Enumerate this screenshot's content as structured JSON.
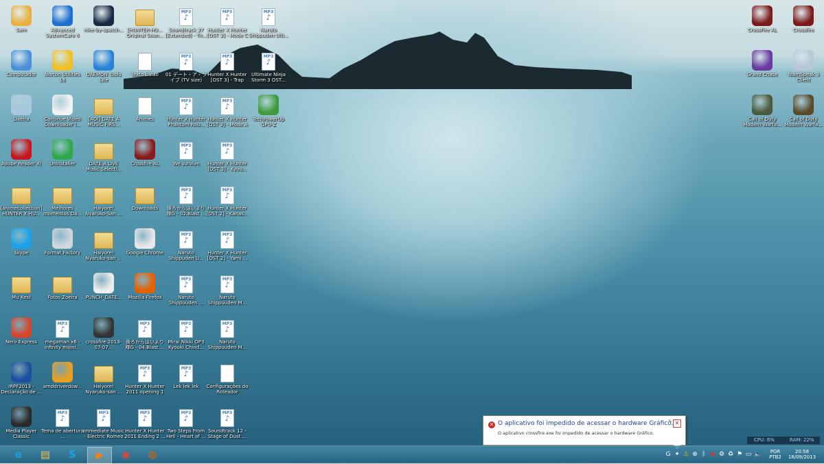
{
  "desktop": {
    "icons": [
      {
        "label": "Sam",
        "icon": "user-icon",
        "kind": "app",
        "color": "#e8b040",
        "col": 0,
        "row": 0
      },
      {
        "label": "Advanced SystemCare 6",
        "icon": "systemcare-icon",
        "kind": "app",
        "color": "#1e6fd0",
        "col": 1,
        "row": 0
      },
      {
        "label": "nike-by-spatch...",
        "icon": "image-icon",
        "kind": "app",
        "color": "#1a2a44",
        "col": 2,
        "row": 0
      },
      {
        "label": "[HUNTER-HU... Original Soun...",
        "icon": "folder-icon",
        "kind": "folder",
        "col": 3,
        "row": 0
      },
      {
        "label": "Soundtrack 37 [Extended] - Th...",
        "icon": "mp3-icon",
        "kind": "mp3",
        "col": 4,
        "row": 0
      },
      {
        "label": "Hunter X Hunter [OST 3] - Mode C",
        "icon": "mp3-icon",
        "kind": "mp3",
        "col": 5,
        "row": 0
      },
      {
        "label": "Naruto Shippuden Ulti...",
        "icon": "mp3-icon",
        "kind": "mp3",
        "col": 6,
        "row": 0
      },
      {
        "label": "Computador",
        "icon": "computer-icon",
        "kind": "app",
        "color": "#4a90d9",
        "col": 0,
        "row": 1
      },
      {
        "label": "Norton Utilities 16",
        "icon": "norton-icon",
        "kind": "app",
        "color": "#f0c020",
        "col": 1,
        "row": 1
      },
      {
        "label": "DAEMON Tools Lite",
        "icon": "daemon-tools-icon",
        "kind": "app",
        "color": "#2a82d8",
        "col": 2,
        "row": 1
      },
      {
        "label": "Texto balao",
        "icon": "text-file-icon",
        "kind": "doc",
        "col": 3,
        "row": 1
      },
      {
        "label": "01 デート・ア・ライブ (TV size)",
        "icon": "mp3-icon",
        "kind": "mp3",
        "col": 4,
        "row": 1
      },
      {
        "label": "Hunter X Hunter [OST 3] - Trap",
        "icon": "mp3-icon",
        "kind": "mp3",
        "col": 5,
        "row": 1
      },
      {
        "label": "Ultimate Ninja Storm 3 OST...",
        "icon": "mp3-icon",
        "kind": "mp3",
        "col": 6,
        "row": 1
      },
      {
        "label": "Lixeira",
        "icon": "recycle-bin-icon",
        "kind": "app",
        "color": "#a9c7de",
        "col": 0,
        "row": 2
      },
      {
        "label": "Continue Video Downloader l...",
        "icon": "video-downloader-icon",
        "kind": "app",
        "color": "#f2f2f2",
        "col": 1,
        "row": 2
      },
      {
        "label": "[AOI] DATE A MUSIC FIRS...",
        "icon": "folder-icon",
        "kind": "folder",
        "col": 2,
        "row": 2
      },
      {
        "label": "Animes",
        "icon": "text-file-icon",
        "kind": "doc",
        "col": 3,
        "row": 2
      },
      {
        "label": "Hunter x Hunter Phantom Rou...",
        "icon": "mp3-icon",
        "kind": "mp3",
        "col": 4,
        "row": 2
      },
      {
        "label": "Hunter X Hunter [OST 3] - Mode A",
        "icon": "mp3-icon",
        "kind": "mp3",
        "col": 5,
        "row": 2
      },
      {
        "label": "TechPowerUp GPU-Z",
        "icon": "gpu-z-icon",
        "kind": "app",
        "color": "#3e9a3e",
        "col": 6,
        "row": 2
      },
      {
        "label": "Adobe Reader XI",
        "icon": "adobe-reader-icon",
        "kind": "app",
        "color": "#c8161d",
        "col": 0,
        "row": 3
      },
      {
        "label": "Uninstaller",
        "icon": "uninstaller-icon",
        "kind": "app",
        "color": "#2da84a",
        "col": 1,
        "row": 3
      },
      {
        "label": "DATE A LIVE Music Selecti...",
        "icon": "folder-icon",
        "kind": "folder",
        "col": 2,
        "row": 3
      },
      {
        "label": "Crossfire AL",
        "icon": "crossfire-icon",
        "kind": "app",
        "color": "#8a1a1a",
        "col": 3,
        "row": 3
      },
      {
        "label": "We survive",
        "icon": "mp3-icon",
        "kind": "mp3",
        "col": 4,
        "row": 3
      },
      {
        "label": "Hunter X Hunter [OST 3] - Kyou...",
        "icon": "mp3-icon",
        "kind": "mp3",
        "col": 5,
        "row": 3
      },
      {
        "label": "[animecollection] HUNTER X HU...",
        "icon": "folder-icon",
        "kind": "folder",
        "col": 0,
        "row": 4
      },
      {
        "label": "Melhores momentos Da...",
        "icon": "folder-icon",
        "kind": "folder",
        "col": 1,
        "row": 4
      },
      {
        "label": "Haiyore! Nyaruko-San ...",
        "icon": "folder-icon",
        "kind": "folder",
        "col": 2,
        "row": 4
      },
      {
        "label": "Downloads",
        "icon": "downloads-folder-icon",
        "kind": "folder",
        "col": 3,
        "row": 4
      },
      {
        "label": "後ろから這いより隊G - 02.Blast ...",
        "icon": "mp3-icon",
        "kind": "mp3",
        "col": 4,
        "row": 4
      },
      {
        "label": "Hunter X Hunter [OST 2] - Kanas...",
        "icon": "mp3-icon",
        "kind": "mp3",
        "col": 5,
        "row": 4
      },
      {
        "label": "Skype",
        "icon": "skype-icon",
        "kind": "app",
        "color": "#1aa3e8",
        "col": 0,
        "row": 5
      },
      {
        "label": "Format Factory",
        "icon": "format-factory-icon",
        "kind": "app",
        "color": "#d0d6de",
        "col": 1,
        "row": 5
      },
      {
        "label": "Haiyore! Nyaruko-san ...",
        "icon": "folder-icon",
        "kind": "folder",
        "col": 2,
        "row": 5
      },
      {
        "label": "Google Chrome",
        "icon": "chrome-icon",
        "kind": "app",
        "color": "#e8e8e8",
        "col": 3,
        "row": 5
      },
      {
        "label": "Naruto Shippuden U...",
        "icon": "mp3-icon",
        "kind": "mp3",
        "col": 4,
        "row": 5
      },
      {
        "label": "Hunter X Hunter [OST 2] - Yami ...",
        "icon": "mp3-icon",
        "kind": "mp3",
        "col": 5,
        "row": 5
      },
      {
        "label": "Mu Kest",
        "icon": "folder-icon",
        "kind": "folder",
        "col": 0,
        "row": 6
      },
      {
        "label": "Fotos Zoeira",
        "icon": "folder-icon",
        "kind": "folder",
        "col": 1,
        "row": 6
      },
      {
        "label": "PUNCH_DATE...",
        "icon": "mkv-file-icon",
        "kind": "app",
        "color": "#eeeeee",
        "col": 2,
        "row": 6
      },
      {
        "label": "Mozilla Firefox",
        "icon": "firefox-icon",
        "kind": "app",
        "color": "#e66000",
        "col": 3,
        "row": 6
      },
      {
        "label": "Naruto Shippuuden ...",
        "icon": "mp3-icon",
        "kind": "mp3",
        "col": 4,
        "row": 6
      },
      {
        "label": "Naruto Shippuuden M...",
        "icon": "mp3-icon",
        "kind": "mp3",
        "col": 5,
        "row": 6
      },
      {
        "label": "Nero Express",
        "icon": "nero-icon",
        "kind": "app",
        "color": "#d8452a",
        "col": 0,
        "row": 7
      },
      {
        "label": "megaman x6 - infinity mijini...",
        "icon": "mp3-icon",
        "kind": "mp3",
        "col": 1,
        "row": 7
      },
      {
        "label": "crossfire 2013-07-07...",
        "icon": "screenshot-icon",
        "kind": "app",
        "color": "#333333",
        "col": 2,
        "row": 7
      },
      {
        "label": "後ろから這いより隊G - 04.Blast ...",
        "icon": "mp3-icon",
        "kind": "mp3",
        "col": 3,
        "row": 7
      },
      {
        "label": "Mirai Nikki OP3 Kyouki Chind...",
        "icon": "mp3-icon",
        "kind": "mp3",
        "col": 4,
        "row": 7
      },
      {
        "label": "Naruto Shippuuden M...",
        "icon": "mp3-icon",
        "kind": "mp3",
        "col": 5,
        "row": 7
      },
      {
        "label": "IRPF2013 - Declaração de ...",
        "icon": "irpf-icon",
        "kind": "app",
        "color": "#1b4fa0",
        "col": 0,
        "row": 8
      },
      {
        "label": "amddriverdow...",
        "icon": "amd-driver-icon",
        "kind": "app",
        "color": "#e8a020",
        "col": 1,
        "row": 8
      },
      {
        "label": "Haiyore! Nyaruko-san ...",
        "icon": "folder-icon",
        "kind": "folder",
        "col": 2,
        "row": 8
      },
      {
        "label": "Hunter X Hunter 2011 opening 1",
        "icon": "mp3-icon",
        "kind": "mp3",
        "col": 3,
        "row": 8
      },
      {
        "label": "Lek lek lek",
        "icon": "wav-icon",
        "kind": "mp3",
        "col": 4,
        "row": 8
      },
      {
        "label": "Configurações do Roteador",
        "icon": "text-file-icon",
        "kind": "doc",
        "col": 5,
        "row": 8
      },
      {
        "label": "Media Player Classic",
        "icon": "media-player-classic-icon",
        "kind": "app",
        "color": "#2a2a2a",
        "col": 0,
        "row": 9
      },
      {
        "label": "Tema de abertura ...",
        "icon": "mp3-icon",
        "kind": "mp3",
        "col": 1,
        "row": 9
      },
      {
        "label": "Immediate Music - Electric Romeo",
        "icon": "mp3-icon",
        "kind": "mp3",
        "col": 2,
        "row": 9
      },
      {
        "label": "Hunter X Hunter 2011 Ending 2 ...",
        "icon": "mp3-icon",
        "kind": "mp3",
        "col": 3,
        "row": 9
      },
      {
        "label": "Two Steps From Hell - Heart of ...",
        "icon": "mp3-icon",
        "kind": "mp3",
        "col": 4,
        "row": 9
      },
      {
        "label": "Soundtrack 12 - Stage of Dust ...",
        "icon": "mp3-icon",
        "kind": "mp3",
        "col": 5,
        "row": 9
      }
    ],
    "right_icons": [
      {
        "label": "CrossFire AL",
        "icon": "crossfire-icon",
        "color": "#7a1a1a",
        "col": 0,
        "row": 0
      },
      {
        "label": "Crossfire",
        "icon": "crossfire-icon",
        "color": "#7a1a1a",
        "col": 1,
        "row": 0
      },
      {
        "label": "Grand Chase",
        "icon": "grand-chase-icon",
        "color": "#6a3aa0",
        "col": 0,
        "row": 1
      },
      {
        "label": "TeamSpeak 3 Client",
        "icon": "teamspeak-icon",
        "color": "#b8c6d6",
        "col": 1,
        "row": 1
      },
      {
        "label": "Call of Duty Modern Warfa...",
        "icon": "call-of-duty-icon",
        "color": "#4a5a3a",
        "col": 0,
        "row": 2
      },
      {
        "label": "Call of Duty Modern Warfa...",
        "icon": "call-of-duty-icon",
        "color": "#5a4a2a",
        "col": 1,
        "row": 2
      }
    ]
  },
  "taskbar": {
    "buttons": [
      {
        "name": "internet-explorer",
        "glyph": "e",
        "color": "#1ea0e8",
        "active": false
      },
      {
        "name": "file-explorer",
        "glyph": "▤",
        "color": "#f0c050",
        "active": false
      },
      {
        "name": "skype",
        "glyph": "S",
        "color": "#1aa3e8",
        "active": false
      },
      {
        "name": "media-player",
        "glyph": "▶",
        "color": "#f08020",
        "active": true
      },
      {
        "name": "google-chrome",
        "glyph": "◉",
        "color": "#e0443a",
        "active": false
      },
      {
        "name": "mozilla-firefox",
        "glyph": "◍",
        "color": "#e66000",
        "active": false
      }
    ],
    "tray_icons": [
      "google-update",
      "crossfire-tray",
      "warning",
      "network-adapter",
      "bluetooth",
      "antivirus",
      "settings",
      "recycle",
      "flag",
      "monitor",
      "volume"
    ],
    "language": {
      "line1": "POR",
      "line2": "PTB2"
    },
    "clock": {
      "time": "20:58",
      "date": "18/09/2013"
    }
  },
  "gadget": {
    "cpu": "CPU: 6%",
    "ram": "RAM: 22%"
  },
  "notification": {
    "title": "O aplicativo foi impedido de acessar o hardware Gráfico.",
    "message": "O aplicativo crossfire.exe foi impedido de acessar o hardware Gráfico."
  }
}
